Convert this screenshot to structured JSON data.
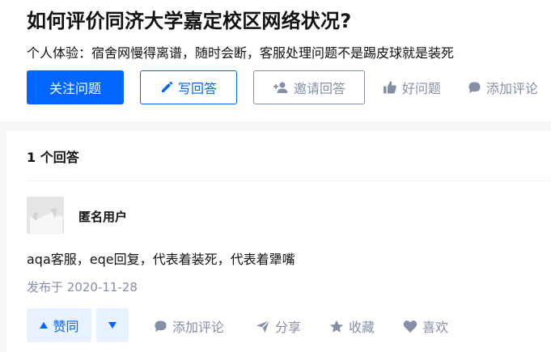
{
  "question": {
    "title": "如何评价同济大学嘉定校区网络状况?",
    "detail": "个人体验：宿舍网慢得离谱，随时会断，客服处理问题不是踢皮球就是装死"
  },
  "actions": {
    "follow": "关注问题",
    "write": "写回答",
    "invite": "邀请回答",
    "good_question": "好问题",
    "add_comment": "添加评论"
  },
  "answers": {
    "count_label": "1 个回答",
    "items": [
      {
        "author": "匿名用户",
        "text": "aqa客服，eqe回复，代表着装死，代表着犟嘴",
        "time": "发布于 2020-11-28",
        "vote_label": "赞同",
        "comment_label": "添加评论",
        "share_label": "分享",
        "collect_label": "收藏",
        "like_label": "喜欢"
      }
    ]
  },
  "icons": {
    "write": "pencil-icon",
    "invite": "add-person-icon",
    "good": "thumbs-up-icon",
    "comment": "comment-bubble-icon",
    "vote_up": "triangle-up-icon",
    "vote_down": "triangle-down-icon",
    "share": "paper-plane-icon",
    "collect": "star-icon",
    "like": "heart-icon"
  },
  "colors": {
    "brand": "#0066ff",
    "muted": "#8590a6",
    "vote_bg": "#e8f1ff",
    "page_bg": "#f6f6f6"
  }
}
